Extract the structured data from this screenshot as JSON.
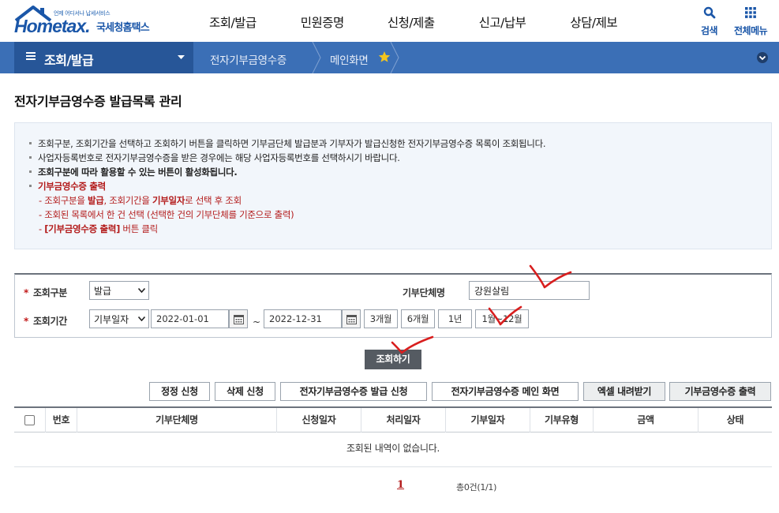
{
  "brand": {
    "tagline": "언제 어디서나 납세서비스",
    "name": "Hometax.",
    "subtitle": "국세청홈택스"
  },
  "main_nav": [
    "조회/발급",
    "민원증명",
    "신청/제출",
    "신고/납부",
    "상담/제보"
  ],
  "top_actions": {
    "search_label": "검색",
    "menu_label": "전체메뉴"
  },
  "breadcrumb": {
    "section": "조회/발급",
    "items": [
      "전자기부금영수증",
      "메인화면"
    ]
  },
  "page_title": "전자기부금영수증 발급목록 관리",
  "info": {
    "line1": "조회구분, 조회기간을 선택하고 조회하기 버튼을 클릭하면 기부금단체 발급분과 기부자가 발급신청한 전자기부금영수증 목록이 조회됩니다.",
    "line2": "사업자등록번호로 전자기부금영수증을 받은 경우에는 해당 사업자등록번호를 선택하시기 바랍니다.",
    "line3": "조회구분에 따라 활용할 수 있는 버튼이 활성화됩니다.",
    "line4": "기부금영수증 출력",
    "sub1_a": "- 조회구분을 ",
    "sub1_b": "발급",
    "sub1_c": ", 조회기간을 ",
    "sub1_d": "기부일자",
    "sub1_e": "로 선택 후 조회",
    "sub2": "- 조회된 목록에서 한 건 선택 (선택한 건의 기부단체를 기준으로 출력)",
    "sub3_a": "- ",
    "sub3_b": "[기부금영수증 출력]",
    "sub3_c": " 버튼 클릭"
  },
  "search": {
    "type_label": "조회구분",
    "type_value": "발급",
    "org_label": "기부단체명",
    "org_value": "강원살림",
    "period_label": "조회기간",
    "period_type": "기부일자",
    "date_from": "2022-01-01",
    "tilde": "~",
    "date_to": "2022-12-31",
    "presets": [
      "3개월",
      "6개월",
      "1년",
      "1월~12월"
    ],
    "submit_label": "조회하기"
  },
  "actions": [
    "정정 신청",
    "삭제 신청",
    "전자기부금영수증 발급 신청",
    "전자기부금영수증 메인 화면",
    "엑셀 내려받기",
    "기부금영수증 출력"
  ],
  "table": {
    "columns": [
      "번호",
      "기부단체명",
      "신청일자",
      "처리일자",
      "기부일자",
      "기부유형",
      "금액",
      "상태"
    ],
    "empty_message": "조회된 내역이 없습니다."
  },
  "pagination": {
    "current_page": "1",
    "total_text": "총0건(1/1)"
  },
  "colors": {
    "brand_blue": "#1a56a8",
    "bar_blue": "#3b6fb6",
    "bar_dark": "#275698",
    "accent_red": "#b31b1b",
    "annotation_red": "#d81e1e"
  }
}
